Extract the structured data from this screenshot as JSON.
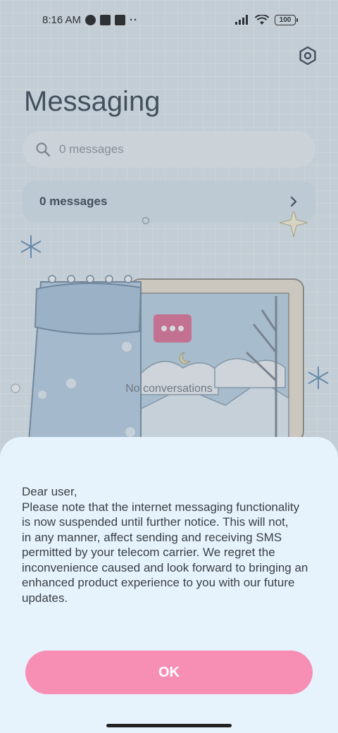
{
  "status_bar": {
    "time": "8:16 AM",
    "battery": "100"
  },
  "header": {
    "title": "Messaging"
  },
  "search": {
    "placeholder": "0 messages"
  },
  "messages_card": {
    "label": "0 messages"
  },
  "empty_state": {
    "label": "No conversations"
  },
  "dialog": {
    "message_lines": [
      "Dear user,",
      "Please note that the internet messaging functionality",
      "is now suspended until further notice. This will not,",
      "in any manner, affect sending and receiving SMS",
      "permitted by your telecom carrier. We regret the",
      "inconvenience caused and look forward to bringing an",
      "enhanced product experience to you with our future",
      "updates."
    ],
    "ok_label": "OK"
  },
  "colors": {
    "accent": "#f78fb5",
    "sheet_background": "#e6f3fc",
    "bubble_icon": "#e36b93"
  },
  "icons": {
    "settings": "hexagon-gear-icon",
    "search": "search-icon",
    "chevron": "chevron-right-icon",
    "chat": "chat-bubble-icon"
  }
}
